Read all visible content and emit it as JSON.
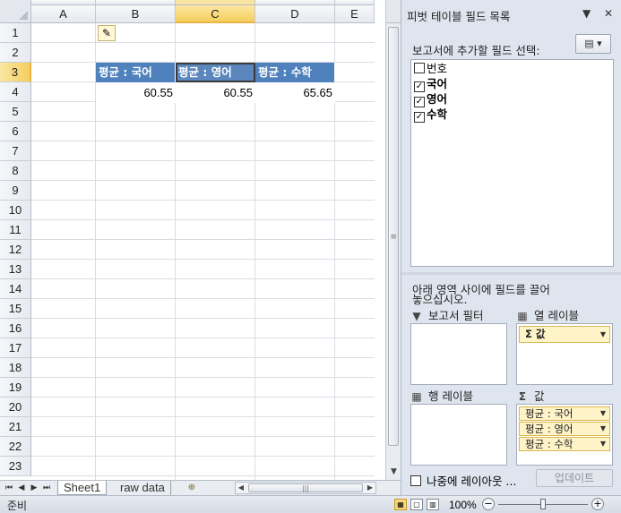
{
  "sheet": {
    "columns": [
      "A",
      "B",
      "C",
      "D",
      "E"
    ],
    "selected_column": "C",
    "rows": [
      "1",
      "2",
      "3",
      "4",
      "5",
      "6",
      "7",
      "8",
      "9",
      "10",
      "11",
      "12",
      "13",
      "14",
      "15",
      "16",
      "17",
      "18",
      "19",
      "20",
      "21",
      "22",
      "23"
    ],
    "selected_row": "3",
    "pivot_headers": [
      "평균 : 국어",
      "평균 : 영어",
      "평균 : 수학"
    ],
    "pivot_values": [
      "60.55",
      "60.55",
      "65.65"
    ],
    "brush_icon": "paintbrush-icon"
  },
  "tabs": {
    "sheets": [
      "Sheet1",
      "raw data"
    ],
    "active": "Sheet1",
    "nav": [
      "first-sheet-icon",
      "prev-sheet-icon",
      "next-sheet-icon",
      "last-sheet-icon"
    ]
  },
  "pane": {
    "title": "피벗 테이블 필드 목록",
    "choose_label": "보고서에 추가할 필드 선택:",
    "fields": [
      {
        "name": "번호",
        "checked": false
      },
      {
        "name": "국어",
        "checked": true
      },
      {
        "name": "영어",
        "checked": true
      },
      {
        "name": "수학",
        "checked": true
      }
    ],
    "drag_label_1": "아래 영역 사이에 필드를 끌어",
    "drag_label_2": "놓으십시오.",
    "areas": {
      "filter": "보고서 필터",
      "columns": "열 레이블",
      "rows": "행 레이블",
      "values": "값"
    },
    "column_chip": "Σ  값",
    "value_chips": [
      "평균 : 국어",
      "평균 : 영어",
      "평균 : 수학"
    ],
    "defer_label": "나중에 레이아웃 ...",
    "update_button": "업데이트"
  },
  "status": {
    "ready": "준비",
    "zoom": "100%"
  }
}
